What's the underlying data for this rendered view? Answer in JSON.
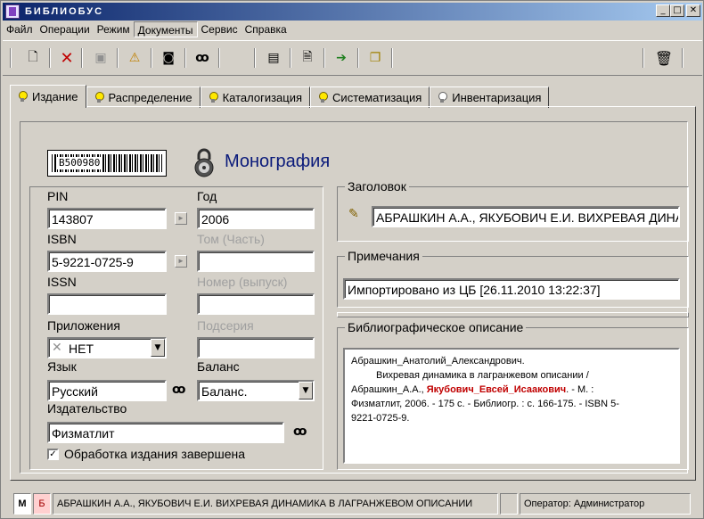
{
  "window": {
    "title": "БИБЛИОБУС"
  },
  "menu": [
    "Файл",
    "Операции",
    "Режим",
    "Документы",
    "Сервис",
    "Справка"
  ],
  "tabs": [
    {
      "label": "Издание",
      "state": "on"
    },
    {
      "label": "Распределение",
      "state": "on"
    },
    {
      "label": "Каталогизация",
      "state": "on"
    },
    {
      "label": "Систематизация",
      "state": "on"
    },
    {
      "label": "Инвентаризация",
      "state": "off"
    }
  ],
  "header": {
    "barcode": "B500980",
    "type": "Монография"
  },
  "left": {
    "pin_label": "PIN",
    "pin": "143807",
    "year_label": "Год",
    "year": "2006",
    "isbn_label": "ISBN",
    "isbn": "5-9221-0725-9",
    "volume_label": "Том (Часть)",
    "volume": "",
    "issn_label": "ISSN",
    "issn": "",
    "number_label": "Номер (выпуск)",
    "number": "",
    "appendix_label": "Приложения",
    "appendix": "НЕТ",
    "subseries_label": "Подсерия",
    "subseries": "",
    "language_label": "Язык",
    "language": "Русский",
    "balance_label": "Баланс",
    "balance": "Баланс.",
    "publisher_label": "Издательство",
    "publisher": "Физматлит",
    "completed_label": "Обработка издания завершена",
    "completed": true
  },
  "right": {
    "title_group": "Заголовок",
    "title_value": "АБРАШКИН А.А., ЯКУБОВИЧ Е.И. ВИХРЕВАЯ ДИНАМИКА В ЛАГРАНЖЕВОМ ОПИСАНИИ",
    "notes_group": "Примечания",
    "notes_value": "Импортировано из ЦБ [26.11.2010 13:22:37]",
    "biblio_group": "Библиографическое описание",
    "biblio_line1": "Абрашкин_Анатолий_Александрович.",
    "biblio_line2": "Вихревая динамика в лагранжевом описании /",
    "biblio_line3a": "Абрашкин_А.А., ",
    "biblio_red": "Якубович_Евсей_Исаакович",
    "biblio_line3b": ". - М. :",
    "biblio_line4": "Физматлит, 2006. - 175 с. - Библиогр. : с. 166-175. - ISBN 5-",
    "biblio_line5": "9221-0725-9."
  },
  "status": {
    "m": "М",
    "b": "Б",
    "record": "АБРАШКИН А.А., ЯКУБОВИЧ Е.И. ВИХРЕВАЯ ДИНАМИКА В ЛАГРАНЖЕВОМ ОПИСАНИИ",
    "operator": "Оператор: Администратор"
  },
  "colors": {
    "titlebar_start": "#0a246a",
    "titlebar_end": "#a6caf0",
    "monograph": "#0a1a7a",
    "author_red": "#c00000",
    "b_badge": "#ffd0d0"
  },
  "icons": [
    "new-icon",
    "delete-icon",
    "save-icon",
    "warning-icon",
    "camera-icon",
    "binoculars-icon",
    "notepad-icon",
    "document-icon",
    "export-icon",
    "copy-icon",
    "trash-icon"
  ]
}
